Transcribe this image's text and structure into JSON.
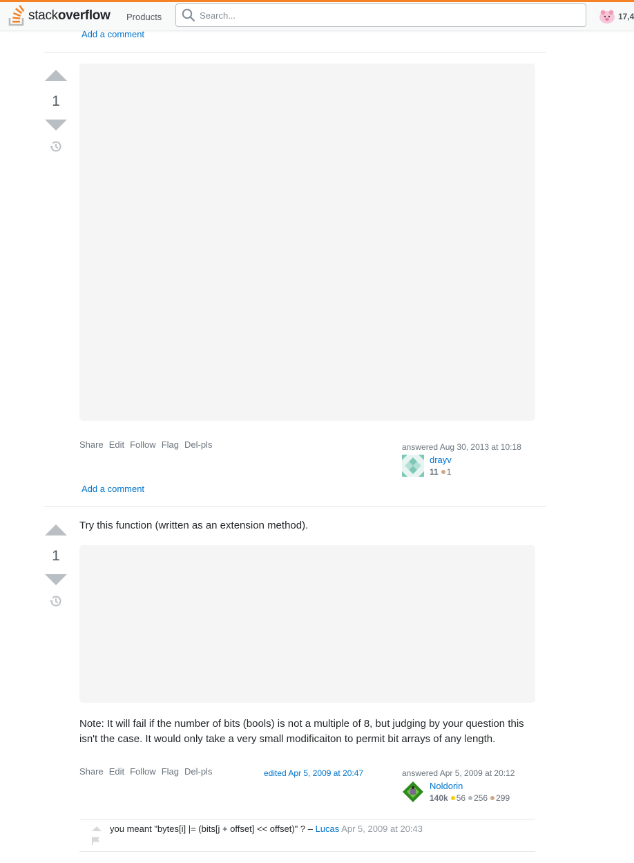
{
  "header": {
    "logo_text_light": "stack",
    "logo_text_bold": "overflow",
    "products_label": "Products",
    "search_placeholder": "Search...",
    "reputation": "17,4"
  },
  "prev_answer": {
    "add_comment_label": "Add a comment"
  },
  "answer1": {
    "vote_count": "1",
    "menu": [
      "Share",
      "Edit",
      "Follow",
      "Flag",
      "Del-pls"
    ],
    "answered_label": "answered Aug 30, 2013 at 10:18",
    "user": {
      "name": "drayv",
      "reputation": "11",
      "bronze": "1"
    },
    "add_comment_label": "Add a comment"
  },
  "answer2": {
    "vote_count": "1",
    "intro_text": "Try this function (written as an extension method).",
    "note_text": "Note: It will fail if the number of bits (bools) is not a multiple of 8, but judging by your question this isn't the case. It would only take a very small modificaiton to permit bit arrays of any length.",
    "menu": [
      "Share",
      "Edit",
      "Follow",
      "Flag",
      "Del-pls"
    ],
    "edited_label": "edited Apr 5, 2009 at 20:47",
    "answered_label": "answered Apr 5, 2009 at 20:12",
    "user": {
      "name": "Noldorin",
      "reputation": "140k",
      "gold": "56",
      "silver": "256",
      "bronze": "299"
    },
    "comment": {
      "text": "you meant \"bytes[i] |= (bits[j + offset] << offset)\" ? –",
      "author": "Lucas",
      "time": "Apr 5, 2009 at 20:43"
    }
  },
  "colors": {
    "accent_orange": "#f48225",
    "link_blue": "#0074cc",
    "gold": "#ffcc01",
    "silver": "#b4b8bc",
    "bronze": "#d1a684"
  }
}
